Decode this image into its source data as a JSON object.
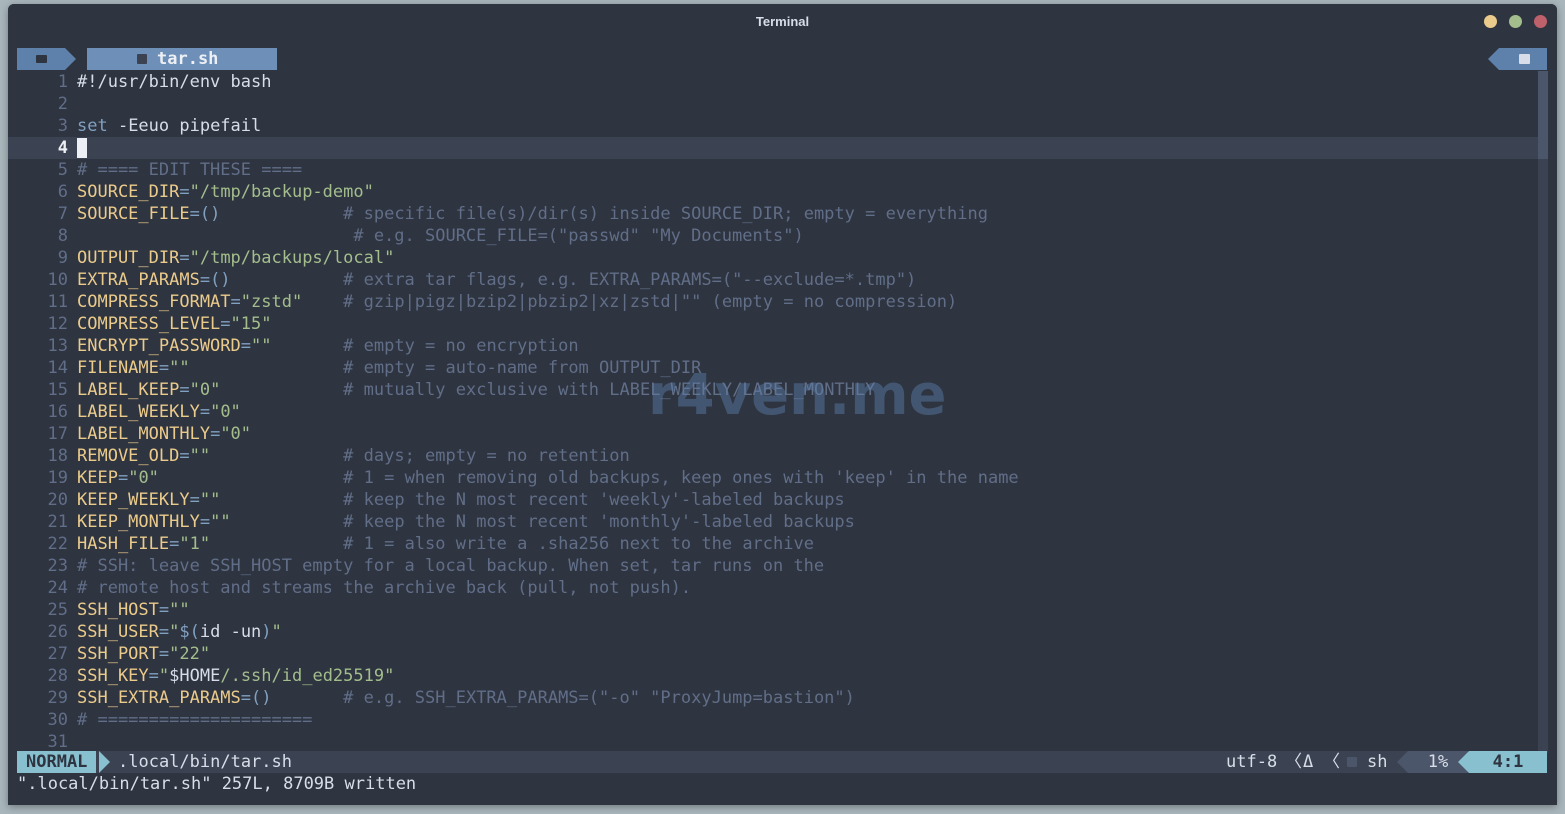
{
  "window": {
    "title": "Terminal",
    "colors": {
      "background": "#2e3440",
      "close": "#bf616a",
      "maximize": "#a3be8c",
      "minimize": "#ebcb8b"
    }
  },
  "tabline": {
    "folder_icon": "folder-icon",
    "active_tab": {
      "icon": "file-icon",
      "label": "tar.sh"
    },
    "right_icon": "terminal-icon"
  },
  "editor": {
    "current_line": 4,
    "watermark": "r4ven.me",
    "lines": [
      {
        "n": "1",
        "segs": [
          {
            "t": "#!/usr/bin/env bash",
            "c": "w"
          }
        ]
      },
      {
        "n": "2",
        "segs": []
      },
      {
        "n": "3",
        "segs": [
          {
            "t": "set",
            "c": "k"
          },
          {
            "t": " -Eeuo pipefail",
            "c": "w"
          }
        ]
      },
      {
        "n": "4",
        "segs": [],
        "cursor": true
      },
      {
        "n": "5",
        "segs": [
          {
            "t": "# ==== EDIT THESE ====",
            "c": "c"
          }
        ]
      },
      {
        "n": "6",
        "segs": [
          {
            "t": "SOURCE_DIR",
            "c": "v"
          },
          {
            "t": "=",
            "c": "o"
          },
          {
            "t": "\"/tmp/backup-demo\"",
            "c": "s"
          }
        ]
      },
      {
        "n": "7",
        "segs": [
          {
            "t": "SOURCE_FILE",
            "c": "v"
          },
          {
            "t": "=()",
            "c": "o"
          },
          {
            "t": "            ",
            "c": "w"
          },
          {
            "t": "# specific file(s)/dir(s) inside SOURCE_DIR; empty = everything",
            "c": "c"
          }
        ]
      },
      {
        "n": "8",
        "segs": [
          {
            "t": "                           ",
            "c": "w"
          },
          {
            "t": "# e.g. SOURCE_FILE=(\"passwd\" \"My Documents\")",
            "c": "c"
          }
        ]
      },
      {
        "n": "9",
        "segs": [
          {
            "t": "OUTPUT_DIR",
            "c": "v"
          },
          {
            "t": "=",
            "c": "o"
          },
          {
            "t": "\"/tmp/backups/local\"",
            "c": "s"
          }
        ]
      },
      {
        "n": "10",
        "segs": [
          {
            "t": "EXTRA_PARAMS",
            "c": "v"
          },
          {
            "t": "=()",
            "c": "o"
          },
          {
            "t": "           ",
            "c": "w"
          },
          {
            "t": "# extra tar flags, e.g. EXTRA_PARAMS=(\"--exclude=*.tmp\")",
            "c": "c"
          }
        ]
      },
      {
        "n": "11",
        "segs": [
          {
            "t": "COMPRESS_FORMAT",
            "c": "v"
          },
          {
            "t": "=",
            "c": "o"
          },
          {
            "t": "\"zstd\"",
            "c": "s"
          },
          {
            "t": "    ",
            "c": "w"
          },
          {
            "t": "# gzip|pigz|bzip2|pbzip2|xz|zstd|\"\" (empty = no compression)",
            "c": "c"
          }
        ]
      },
      {
        "n": "12",
        "segs": [
          {
            "t": "COMPRESS_LEVEL",
            "c": "v"
          },
          {
            "t": "=",
            "c": "o"
          },
          {
            "t": "\"15\"",
            "c": "s"
          }
        ]
      },
      {
        "n": "13",
        "segs": [
          {
            "t": "ENCRYPT_PASSWORD",
            "c": "v"
          },
          {
            "t": "=",
            "c": "o"
          },
          {
            "t": "\"\"",
            "c": "s"
          },
          {
            "t": "       ",
            "c": "w"
          },
          {
            "t": "# empty = no encryption",
            "c": "c"
          }
        ]
      },
      {
        "n": "14",
        "segs": [
          {
            "t": "FILENAME",
            "c": "v"
          },
          {
            "t": "=",
            "c": "o"
          },
          {
            "t": "\"\"",
            "c": "s"
          },
          {
            "t": "               ",
            "c": "w"
          },
          {
            "t": "# empty = auto-name from OUTPUT_DIR",
            "c": "c"
          }
        ]
      },
      {
        "n": "15",
        "segs": [
          {
            "t": "LABEL_KEEP",
            "c": "v"
          },
          {
            "t": "=",
            "c": "o"
          },
          {
            "t": "\"0\"",
            "c": "s"
          },
          {
            "t": "            ",
            "c": "w"
          },
          {
            "t": "# mutually exclusive with LABEL_WEEKLY/LABEL_MONTHLY",
            "c": "c"
          }
        ]
      },
      {
        "n": "16",
        "segs": [
          {
            "t": "LABEL_WEEKLY",
            "c": "v"
          },
          {
            "t": "=",
            "c": "o"
          },
          {
            "t": "\"0\"",
            "c": "s"
          }
        ]
      },
      {
        "n": "17",
        "segs": [
          {
            "t": "LABEL_MONTHLY",
            "c": "v"
          },
          {
            "t": "=",
            "c": "o"
          },
          {
            "t": "\"0\"",
            "c": "s"
          }
        ]
      },
      {
        "n": "18",
        "segs": [
          {
            "t": "REMOVE_OLD",
            "c": "v"
          },
          {
            "t": "=",
            "c": "o"
          },
          {
            "t": "\"\"",
            "c": "s"
          },
          {
            "t": "             ",
            "c": "w"
          },
          {
            "t": "# days; empty = no retention",
            "c": "c"
          }
        ]
      },
      {
        "n": "19",
        "segs": [
          {
            "t": "KEEP",
            "c": "v"
          },
          {
            "t": "=",
            "c": "o"
          },
          {
            "t": "\"0\"",
            "c": "s"
          },
          {
            "t": "                  ",
            "c": "w"
          },
          {
            "t": "# 1 = when removing old backups, keep ones with 'keep' in the name",
            "c": "c"
          }
        ]
      },
      {
        "n": "20",
        "segs": [
          {
            "t": "KEEP_WEEKLY",
            "c": "v"
          },
          {
            "t": "=",
            "c": "o"
          },
          {
            "t": "\"\"",
            "c": "s"
          },
          {
            "t": "            ",
            "c": "w"
          },
          {
            "t": "# keep the N most recent 'weekly'-labeled backups",
            "c": "c"
          }
        ]
      },
      {
        "n": "21",
        "segs": [
          {
            "t": "KEEP_MONTHLY",
            "c": "v"
          },
          {
            "t": "=",
            "c": "o"
          },
          {
            "t": "\"\"",
            "c": "s"
          },
          {
            "t": "           ",
            "c": "w"
          },
          {
            "t": "# keep the N most recent 'monthly'-labeled backups",
            "c": "c"
          }
        ]
      },
      {
        "n": "22",
        "segs": [
          {
            "t": "HASH_FILE",
            "c": "v"
          },
          {
            "t": "=",
            "c": "o"
          },
          {
            "t": "\"1\"",
            "c": "s"
          },
          {
            "t": "             ",
            "c": "w"
          },
          {
            "t": "# 1 = also write a .sha256 next to the archive",
            "c": "c"
          }
        ]
      },
      {
        "n": "23",
        "segs": [
          {
            "t": "# SSH: leave SSH_HOST empty for a local backup. When set, tar runs on the",
            "c": "c"
          }
        ]
      },
      {
        "n": "24",
        "segs": [
          {
            "t": "# remote host and streams the archive back (pull, not push).",
            "c": "c"
          }
        ]
      },
      {
        "n": "25",
        "segs": [
          {
            "t": "SSH_HOST",
            "c": "v"
          },
          {
            "t": "=",
            "c": "o"
          },
          {
            "t": "\"\"",
            "c": "s"
          }
        ]
      },
      {
        "n": "26",
        "segs": [
          {
            "t": "SSH_USER",
            "c": "v"
          },
          {
            "t": "=",
            "c": "o"
          },
          {
            "t": "\"",
            "c": "s"
          },
          {
            "t": "$(",
            "c": "o"
          },
          {
            "t": "id -un",
            "c": "w"
          },
          {
            "t": ")",
            "c": "o"
          },
          {
            "t": "\"",
            "c": "s"
          }
        ]
      },
      {
        "n": "27",
        "segs": [
          {
            "t": "SSH_PORT",
            "c": "v"
          },
          {
            "t": "=",
            "c": "o"
          },
          {
            "t": "\"22\"",
            "c": "s"
          }
        ]
      },
      {
        "n": "28",
        "segs": [
          {
            "t": "SSH_KEY",
            "c": "v"
          },
          {
            "t": "=",
            "c": "o"
          },
          {
            "t": "\"",
            "c": "s"
          },
          {
            "t": "$HOME",
            "c": "w"
          },
          {
            "t": "/.ssh/id_ed25519\"",
            "c": "s"
          }
        ]
      },
      {
        "n": "29",
        "segs": [
          {
            "t": "SSH_EXTRA_PARAMS",
            "c": "v"
          },
          {
            "t": "=()",
            "c": "o"
          },
          {
            "t": "       ",
            "c": "w"
          },
          {
            "t": "# e.g. SSH_EXTRA_PARAMS=(\"-o\" \"ProxyJump=bastion\")",
            "c": "c"
          }
        ]
      },
      {
        "n": "30",
        "segs": [
          {
            "t": "# =====================",
            "c": "c"
          }
        ]
      },
      {
        "n": "31",
        "segs": []
      }
    ]
  },
  "statusline": {
    "mode": "NORMAL",
    "path": ".local/bin/tar.sh",
    "encoding": "utf-8",
    "separator": "〈",
    "os_icon": "Δ",
    "filetype_icon": "file-icon",
    "filetype": "sh",
    "percent": "1%",
    "position": "4:1"
  },
  "cmdline": {
    "message": "\".local/bin/tar.sh\" 257L, 8709B written"
  }
}
